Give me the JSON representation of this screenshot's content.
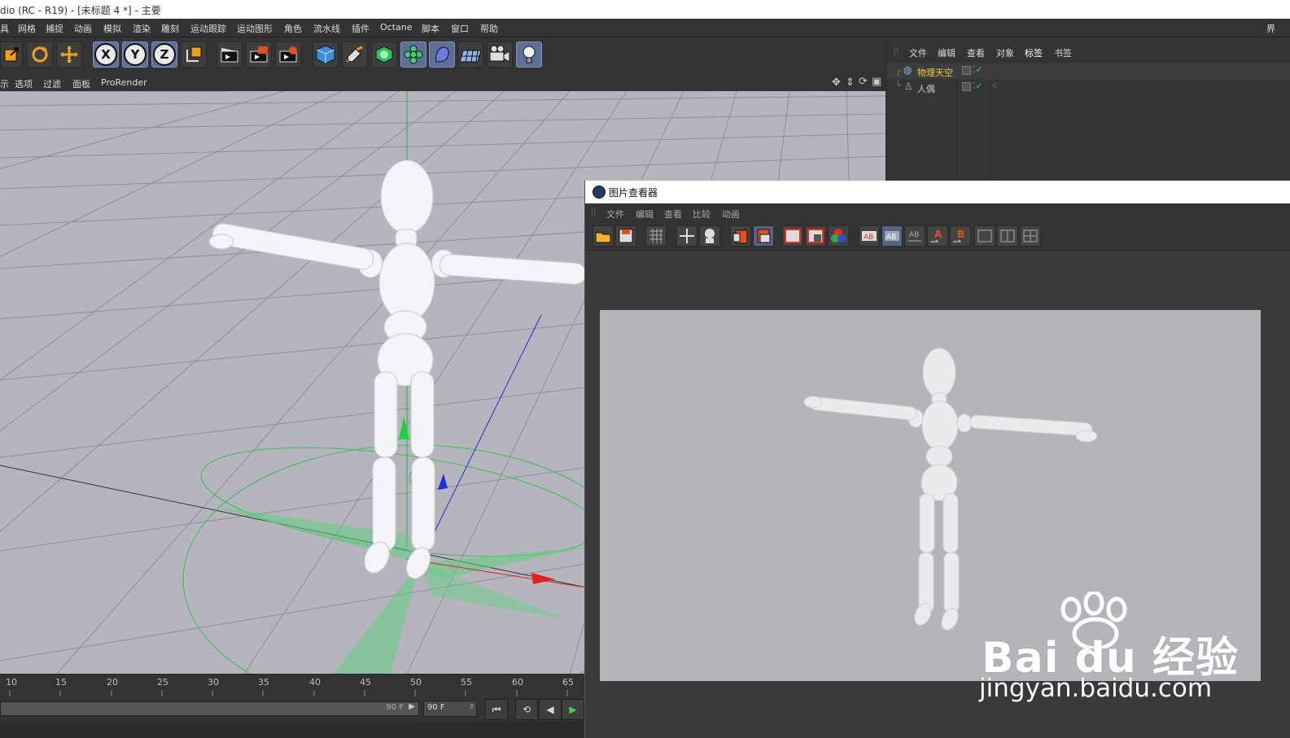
{
  "window": {
    "title": "dio (RC - R19) - [未标题 4 *] - 主要"
  },
  "menubar": {
    "items": [
      "具",
      "网格",
      "捕捉",
      "动画",
      "模拟",
      "渲染",
      "雕刻",
      "运动跟踪",
      "运动图形",
      "角色",
      "流水线",
      "插件",
      "Octane",
      "脚本",
      "窗口",
      "帮助"
    ],
    "right_label": "界"
  },
  "toolbar": {
    "axis_x": "X",
    "axis_y": "Y",
    "axis_z": "Z"
  },
  "viewport_menu": {
    "items": [
      "示",
      "选项",
      "过滤",
      "面板",
      "ProRender"
    ]
  },
  "object_manager": {
    "menu": [
      "文件",
      "编辑",
      "查看",
      "对象",
      "标签",
      "书签"
    ],
    "objects": [
      {
        "name": "物理天空",
        "icon": "sky-icon",
        "color": "#f2c84b"
      },
      {
        "name": "人偶",
        "icon": "figure-icon",
        "color": "#c8c8c8"
      }
    ]
  },
  "picture_viewer": {
    "title": "图片查看器",
    "menu": [
      "文件",
      "编辑",
      "查看",
      "比较",
      "动画"
    ]
  },
  "timeline": {
    "ticks": [
      "10",
      "15",
      "20",
      "25",
      "30",
      "35",
      "40",
      "45",
      "50",
      "55",
      "60",
      "65"
    ],
    "end_frame": "90 F",
    "end_frame_field": "90 F"
  },
  "watermark": {
    "brand": "Bai du 经验",
    "url": "jingyan.baidu.com"
  },
  "colors": {
    "accent": "#f2c84b",
    "axis_x": "#e02020",
    "axis_y": "#20c020",
    "axis_z": "#2030d0"
  }
}
